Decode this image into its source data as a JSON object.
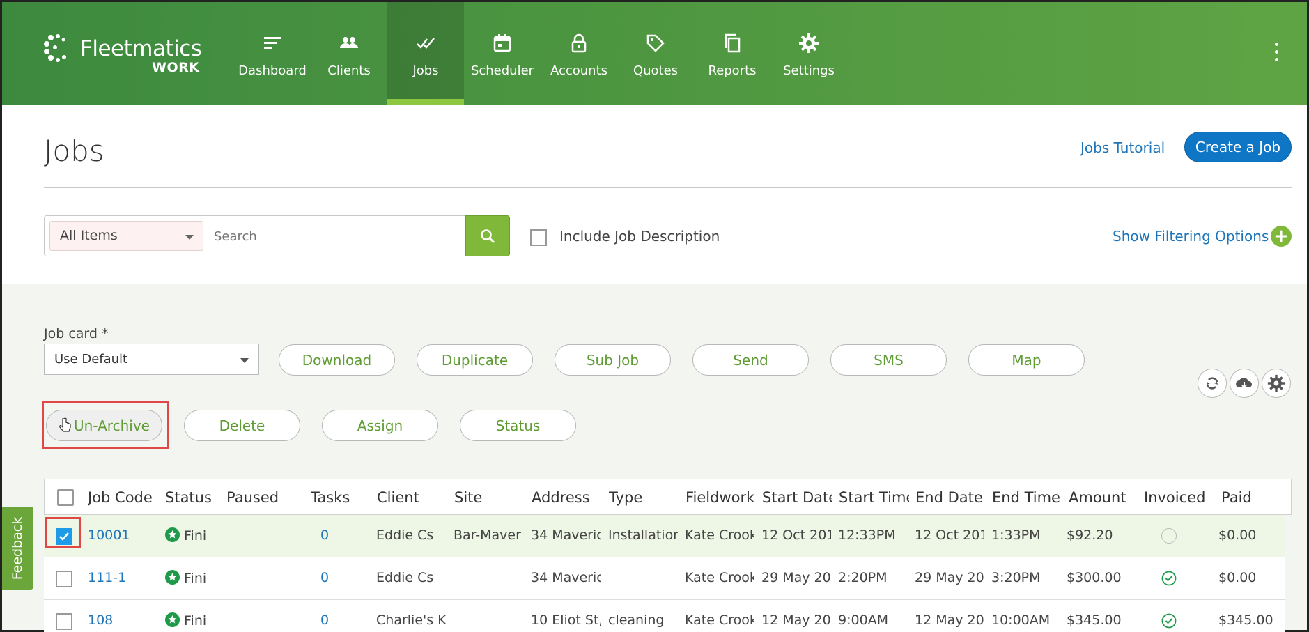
{
  "app": {
    "logo_text": "Fleetmatics",
    "logo_sub": "WORK"
  },
  "nav": [
    {
      "label": "Dashboard",
      "icon": "dashboard-icon"
    },
    {
      "label": "Clients",
      "icon": "clients-icon"
    },
    {
      "label": "Jobs",
      "icon": "jobs-icon",
      "active": true
    },
    {
      "label": "Scheduler",
      "icon": "calendar-icon"
    },
    {
      "label": "Accounts",
      "icon": "lock-icon"
    },
    {
      "label": "Quotes",
      "icon": "tag-icon"
    },
    {
      "label": "Reports",
      "icon": "copy-icon"
    },
    {
      "label": "Settings",
      "icon": "gear-icon"
    }
  ],
  "header": {
    "title": "Jobs",
    "tutorial_link": "Jobs Tutorial",
    "create_button": "Create a Job"
  },
  "search": {
    "filter_value": "All Items",
    "placeholder": "Search",
    "include_description_label": "Include Job Description",
    "show_filtering": "Show Filtering Options"
  },
  "jobcard": {
    "label": "Job card *",
    "value": "Use Default"
  },
  "actions_row1": [
    "Download",
    "Duplicate",
    "Sub Job",
    "Send",
    "SMS",
    "Map"
  ],
  "actions_row2": [
    "Un-Archive",
    "Delete",
    "Assign",
    "Status"
  ],
  "table": {
    "headers": [
      "Job Code",
      "Status",
      "Paused",
      "Tasks",
      "Client",
      "Site",
      "Address",
      "Type",
      "Fieldwork",
      "Start Date",
      "Start Time",
      "End Date",
      "End Time",
      "Amount",
      "Invoiced",
      "Paid"
    ],
    "rows": [
      {
        "job_code": "10001",
        "status": "Fini",
        "paused": "",
        "tasks": "0",
        "client": "Eddie Cs",
        "site": "Bar-Maver",
        "address": "34 Maveric",
        "type": "Installation",
        "fieldwork": "Kate Crook",
        "start_date": "12 Oct 201",
        "start_time": "12:33PM",
        "end_date": "12 Oct 201",
        "end_time": "1:33PM",
        "amount": "$92.20",
        "invoiced": false,
        "paid": "$0.00",
        "checked": true
      },
      {
        "job_code": "111-1",
        "status": "Fini",
        "paused": "",
        "tasks": "0",
        "client": "Eddie Cs",
        "site": "",
        "address": "34 Maveric",
        "type": "",
        "fieldwork": "Kate Crook",
        "start_date": "29 May 20",
        "start_time": "2:20PM",
        "end_date": "29 May 20",
        "end_time": "3:20PM",
        "amount": "$300.00",
        "invoiced": true,
        "paid": "$0.00",
        "checked": false
      },
      {
        "job_code": "108",
        "status": "Fini",
        "paused": "",
        "tasks": "0",
        "client": "Charlie's K",
        "site": "",
        "address": "10 Eliot St,",
        "type": "cleaning",
        "fieldwork": "Kate Crook",
        "start_date": "12 May 20",
        "start_time": "9:00AM",
        "end_date": "12 May 20",
        "end_time": "10:00AM",
        "amount": "$345.00",
        "invoiced": true,
        "paid": "$345.00",
        "checked": false
      }
    ]
  },
  "feedback_label": "Feedback",
  "colors": {
    "brand_green": "#4b9440",
    "accent_green": "#80b93a",
    "link_blue": "#1e75b9",
    "button_blue": "#0f76c6",
    "highlight_red": "#e04848"
  }
}
